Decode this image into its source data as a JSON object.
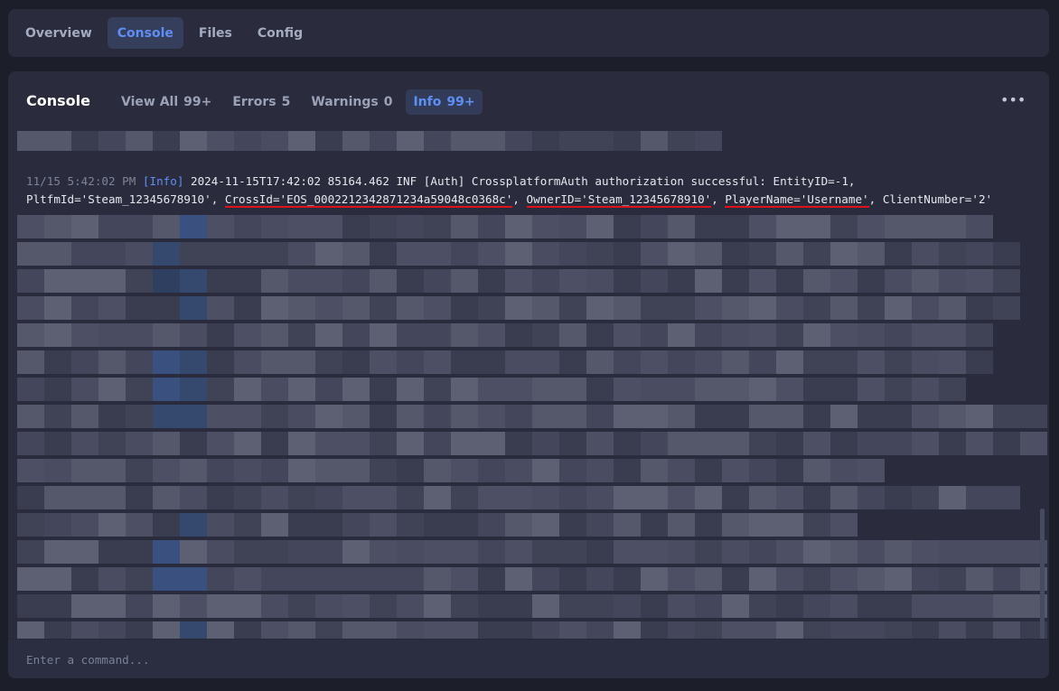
{
  "nav": {
    "tabs": [
      {
        "label": "Overview"
      },
      {
        "label": "Console"
      },
      {
        "label": "Files"
      },
      {
        "label": "Config"
      }
    ],
    "active_tab": "Console"
  },
  "console": {
    "title": "Console",
    "filters": [
      {
        "label": "View All",
        "count": "99+"
      },
      {
        "label": "Errors",
        "count": "5"
      },
      {
        "label": "Warnings",
        "count": "0"
      },
      {
        "label": "Info",
        "count": "99+"
      }
    ],
    "active_filter": "Info",
    "more_icon": "more-horizontal-icon",
    "entry": {
      "timestamp": "11/15 5:42:02 PM",
      "level": "[Info]",
      "line1_rest": "2024-11-15T17:42:02 85164.462 INF [Auth] CrossplatformAuth authorization successful: EntityID=-1,",
      "pltfm": "PltfmId='Steam_12345678910'",
      "sep": ", ",
      "crossid": "CrossId='EOS_0002212342871234a59048c0368c'",
      "ownerid": "OwnerID='Steam_12345678910'",
      "playername": "PlayerName='Username'",
      "clientnumber": "ClientNumber='2'"
    },
    "input_placeholder": "Enter a command..."
  },
  "colors": {
    "accent": "#5e8ff5",
    "panel_bg": "#2a2c3e",
    "page_bg": "#1c1e2a",
    "annotation_underline": "#e0111b"
  }
}
